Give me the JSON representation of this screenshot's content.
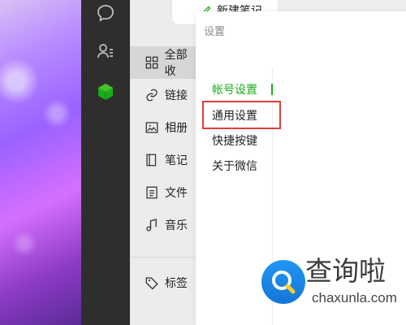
{
  "app": {
    "new_note_label": "新建笔记"
  },
  "sidebar": {
    "icons": [
      "chat-icon",
      "contacts-icon",
      "favorites-icon"
    ],
    "items": [
      {
        "label": "全部收",
        "icon": "grid-icon"
      },
      {
        "label": "链接",
        "icon": "link-icon"
      },
      {
        "label": "相册",
        "icon": "image-icon"
      },
      {
        "label": "笔记",
        "icon": "notebook-icon"
      },
      {
        "label": "文件",
        "icon": "file-icon"
      },
      {
        "label": "音乐",
        "icon": "music-icon"
      },
      {
        "label": "标签",
        "icon": "tag-icon"
      }
    ]
  },
  "settings": {
    "title": "设置",
    "menu": [
      {
        "label": "帐号设置",
        "active": true
      },
      {
        "label": "通用设置",
        "active": false
      },
      {
        "label": "快捷按键",
        "active": false
      },
      {
        "label": "关于微信",
        "active": false
      }
    ]
  },
  "watermark": {
    "brand": "查询啦",
    "url": "chaxunla.com"
  },
  "colors": {
    "accent": "#1aad19",
    "highlight": "#e33d3d",
    "nav_bg": "#2e2e2e"
  }
}
